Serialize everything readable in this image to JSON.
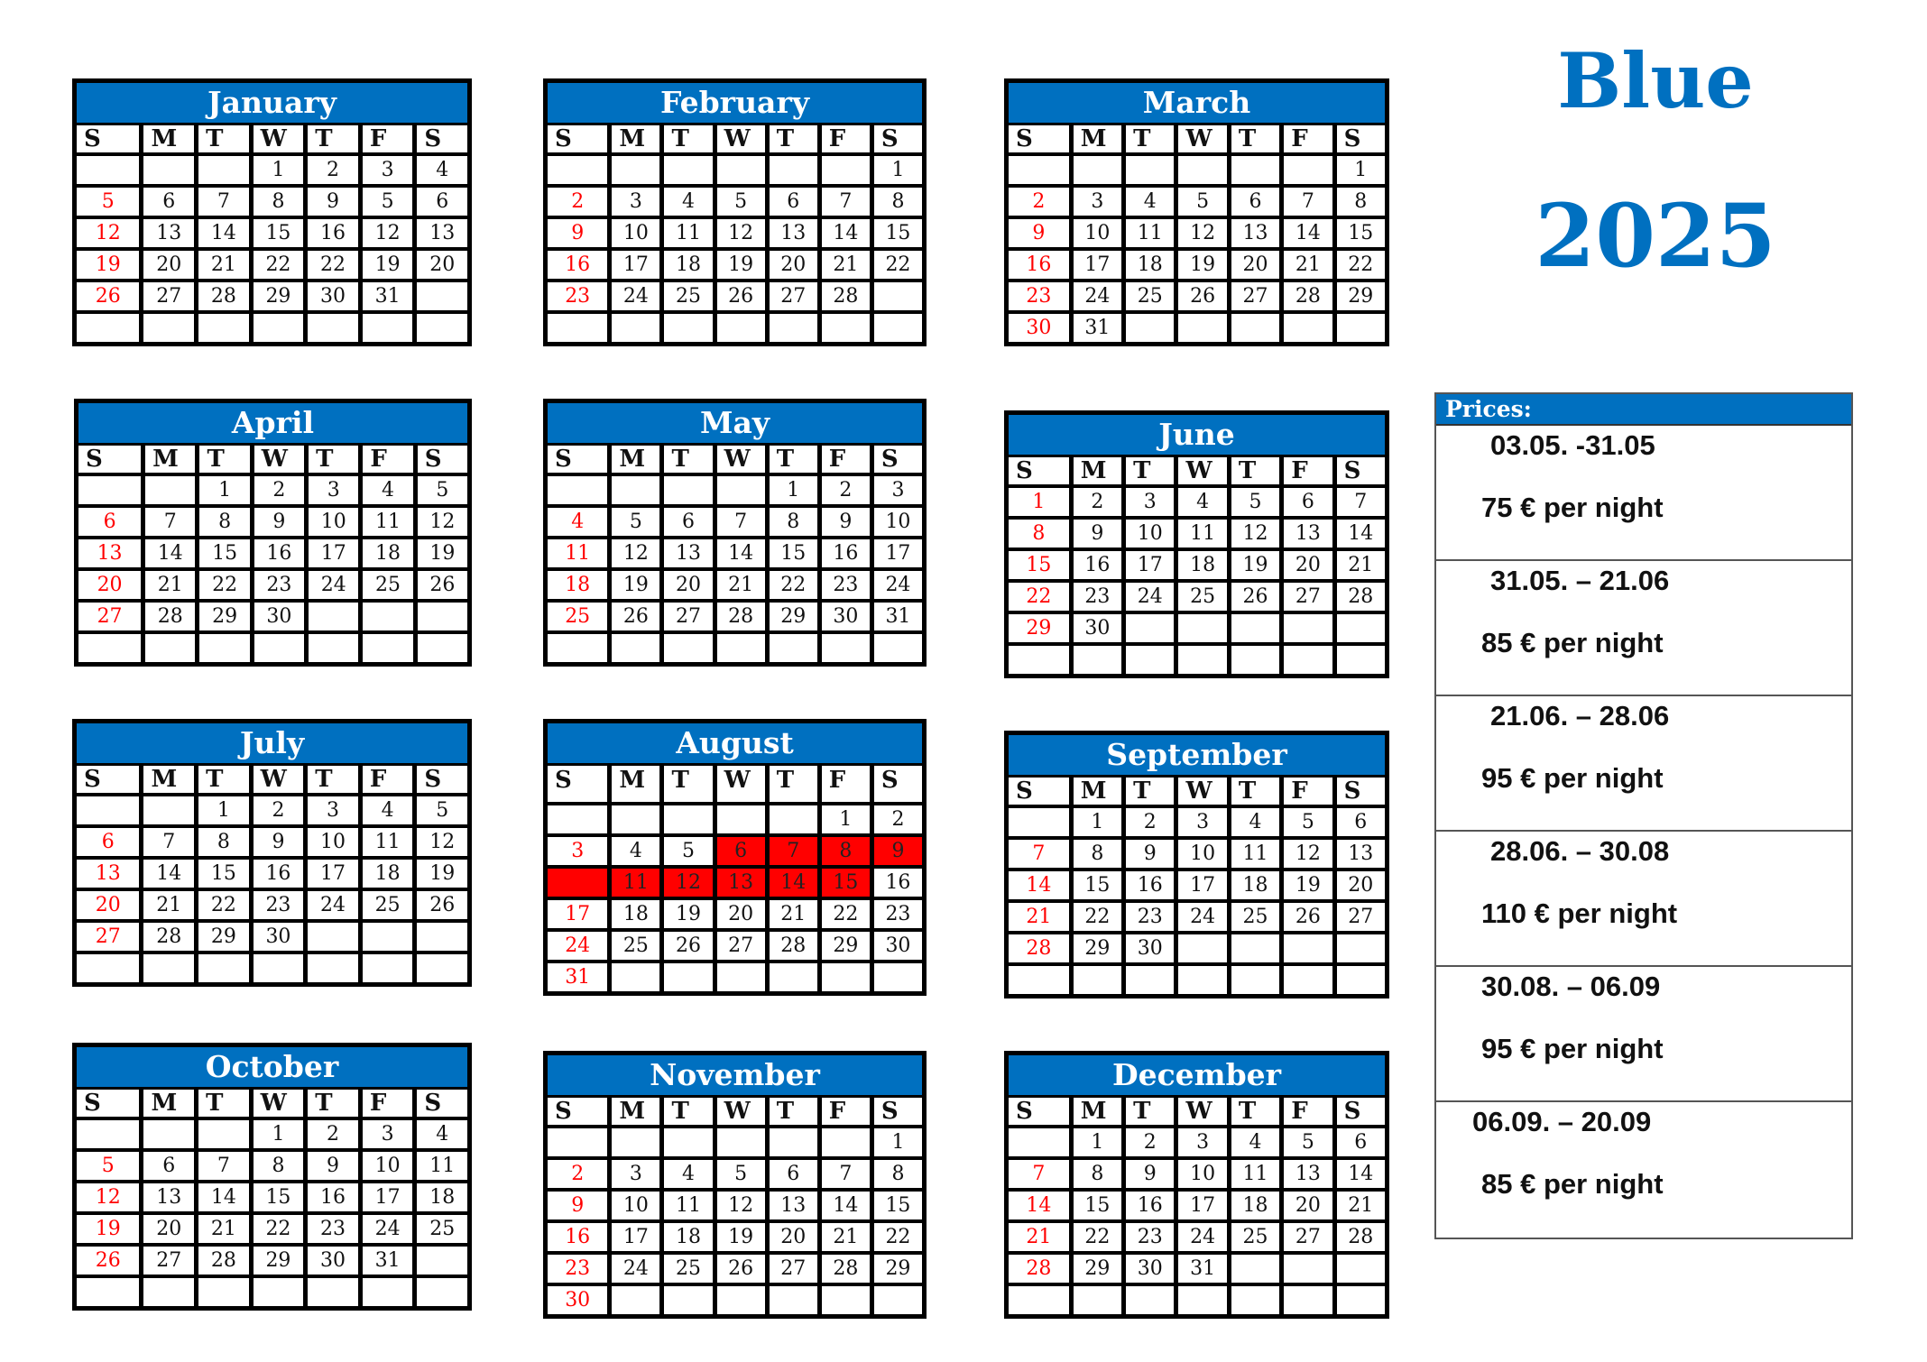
{
  "title": {
    "line1": "Blue",
    "line2": "2025"
  },
  "colors": {
    "accent": "#0070c0",
    "sunday": "#ff0000",
    "booked": "#ff0000"
  },
  "weekdays": [
    "S",
    "M",
    "T",
    "W",
    "T",
    "F",
    "S"
  ],
  "months": [
    {
      "name": "January",
      "weeks": [
        [
          "",
          "",
          "",
          "1",
          "2",
          "3",
          "4"
        ],
        [
          "5",
          "6",
          "7",
          "8",
          "9",
          "5",
          "6"
        ],
        [
          "12",
          "13",
          "14",
          "15",
          "16",
          "12",
          "13"
        ],
        [
          "19",
          "20",
          "21",
          "22",
          "22",
          "19",
          "20"
        ],
        [
          "26",
          "27",
          "28",
          "29",
          "30",
          "31",
          ""
        ],
        [
          "",
          "",
          "",
          "",
          "",
          "",
          ""
        ]
      ]
    },
    {
      "name": "February",
      "weeks": [
        [
          "",
          "",
          "",
          "",
          "",
          "",
          "1"
        ],
        [
          "2",
          "3",
          "4",
          "5",
          "6",
          "7",
          "8"
        ],
        [
          "9",
          "10",
          "11",
          "12",
          "13",
          "14",
          "15"
        ],
        [
          "16",
          "17",
          "18",
          "19",
          "20",
          "21",
          "22"
        ],
        [
          "23",
          "24",
          "25",
          "26",
          "27",
          "28",
          ""
        ],
        [
          "",
          "",
          "",
          "",
          "",
          "",
          ""
        ]
      ]
    },
    {
      "name": "March",
      "weeks": [
        [
          "",
          "",
          "",
          "",
          "",
          "",
          "1"
        ],
        [
          "2",
          "3",
          "4",
          "5",
          "6",
          "7",
          "8"
        ],
        [
          "9",
          "10",
          "11",
          "12",
          "13",
          "14",
          "15"
        ],
        [
          "16",
          "17",
          "18",
          "19",
          "20",
          "21",
          "22"
        ],
        [
          "23",
          "24",
          "25",
          "26",
          "27",
          "28",
          "29"
        ],
        [
          "30",
          "31",
          "",
          "",
          "",
          "",
          ""
        ]
      ]
    },
    {
      "name": "April",
      "weeks": [
        [
          "",
          "",
          "1",
          "2",
          "3",
          "4",
          "5"
        ],
        [
          "6",
          "7",
          "8",
          "9",
          "10",
          "11",
          "12"
        ],
        [
          "13",
          "14",
          "15",
          "16",
          "17",
          "18",
          "19"
        ],
        [
          "20",
          "21",
          "22",
          "23",
          "24",
          "25",
          "26"
        ],
        [
          "27",
          "28",
          "29",
          "30",
          "",
          "",
          ""
        ],
        [
          "",
          "",
          "",
          "",
          "",
          "",
          ""
        ]
      ]
    },
    {
      "name": "May",
      "weeks": [
        [
          "",
          "",
          "",
          "",
          "1",
          "2",
          "3"
        ],
        [
          "4",
          "5",
          "6",
          "7",
          "8",
          "9",
          "10"
        ],
        [
          "11",
          "12",
          "13",
          "14",
          "15",
          "16",
          "17"
        ],
        [
          "18",
          "19",
          "20",
          "21",
          "22",
          "23",
          "24"
        ],
        [
          "25",
          "26",
          "27",
          "28",
          "29",
          "30",
          "31"
        ],
        [
          "",
          "",
          "",
          "",
          "",
          "",
          ""
        ]
      ]
    },
    {
      "name": "June",
      "weeks": [
        [
          "1",
          "2",
          "3",
          "4",
          "5",
          "6",
          "7"
        ],
        [
          "8",
          "9",
          "10",
          "11",
          "12",
          "13",
          "14"
        ],
        [
          "15",
          "16",
          "17",
          "18",
          "19",
          "20",
          "21"
        ],
        [
          "22",
          "23",
          "24",
          "25",
          "26",
          "27",
          "28"
        ],
        [
          "29",
          "30",
          "",
          "",
          "",
          "",
          ""
        ],
        [
          "",
          "",
          "",
          "",
          "",
          "",
          ""
        ]
      ]
    },
    {
      "name": "July",
      "weeks": [
        [
          "",
          "",
          "1",
          "2",
          "3",
          "4",
          "5"
        ],
        [
          "6",
          "7",
          "8",
          "9",
          "10",
          "11",
          "12"
        ],
        [
          "13",
          "14",
          "15",
          "16",
          "17",
          "18",
          "19"
        ],
        [
          "20",
          "21",
          "22",
          "23",
          "24",
          "25",
          "26"
        ],
        [
          "27",
          "28",
          "29",
          "30",
          "",
          "",
          ""
        ],
        [
          "",
          "",
          "",
          "",
          "",
          "",
          ""
        ]
      ]
    },
    {
      "name": "August",
      "weeks": [
        [
          "",
          "",
          "",
          "",
          "",
          "1",
          "2"
        ],
        [
          "3",
          "4",
          "5",
          "6",
          "7",
          "8",
          "9"
        ],
        [
          "",
          "11",
          "12",
          "13",
          "14",
          "15",
          "16"
        ],
        [
          "17",
          "18",
          "19",
          "20",
          "21",
          "22",
          "23"
        ],
        [
          "24",
          "25",
          "26",
          "27",
          "28",
          "29",
          "30"
        ],
        [
          "31",
          "",
          "",
          "",
          "",
          "",
          ""
        ]
      ],
      "booked": [
        [
          1,
          3
        ],
        [
          1,
          4
        ],
        [
          1,
          5
        ],
        [
          1,
          6
        ],
        [
          2,
          0
        ],
        [
          2,
          1
        ],
        [
          2,
          2
        ],
        [
          2,
          3
        ],
        [
          2,
          4
        ],
        [
          2,
          5
        ]
      ]
    },
    {
      "name": "September",
      "weeks": [
        [
          "",
          "1",
          "2",
          "3",
          "4",
          "5",
          "6"
        ],
        [
          "7",
          "8",
          "9",
          "10",
          "11",
          "12",
          "13"
        ],
        [
          "14",
          "15",
          "16",
          "17",
          "18",
          "19",
          "20"
        ],
        [
          "21",
          "22",
          "23",
          "24",
          "25",
          "26",
          "27"
        ],
        [
          "28",
          "29",
          "30",
          "",
          "",
          "",
          ""
        ],
        [
          "",
          "",
          "",
          "",
          "",
          "",
          ""
        ]
      ]
    },
    {
      "name": "October",
      "weeks": [
        [
          "",
          "",
          "",
          "1",
          "2",
          "3",
          "4"
        ],
        [
          "5",
          "6",
          "7",
          "8",
          "9",
          "10",
          "11"
        ],
        [
          "12",
          "13",
          "14",
          "15",
          "16",
          "17",
          "18"
        ],
        [
          "19",
          "20",
          "21",
          "22",
          "23",
          "24",
          "25"
        ],
        [
          "26",
          "27",
          "28",
          "29",
          "30",
          "31",
          ""
        ],
        [
          "",
          "",
          "",
          "",
          "",
          "",
          ""
        ]
      ]
    },
    {
      "name": "November",
      "weeks": [
        [
          "",
          "",
          "",
          "",
          "",
          "",
          "1"
        ],
        [
          "2",
          "3",
          "4",
          "5",
          "6",
          "7",
          "8"
        ],
        [
          "9",
          "10",
          "11",
          "12",
          "13",
          "14",
          "15"
        ],
        [
          "16",
          "17",
          "18",
          "19",
          "20",
          "21",
          "22"
        ],
        [
          "23",
          "24",
          "25",
          "26",
          "27",
          "28",
          "29"
        ],
        [
          "30",
          "",
          "",
          "",
          "",
          "",
          ""
        ]
      ]
    },
    {
      "name": "December",
      "weeks": [
        [
          "",
          "1",
          "2",
          "3",
          "4",
          "5",
          "6"
        ],
        [
          "7",
          "8",
          "9",
          "10",
          "11",
          "13",
          "14"
        ],
        [
          "14",
          "15",
          "16",
          "17",
          "18",
          "20",
          "21"
        ],
        [
          "21",
          "22",
          "23",
          "24",
          "25",
          "27",
          "28"
        ],
        [
          "28",
          "29",
          "30",
          "31",
          "",
          "",
          ""
        ],
        [
          "",
          "",
          "",
          "",
          "",
          "",
          ""
        ]
      ]
    }
  ],
  "prices": {
    "header": "Prices:",
    "periods": [
      {
        "range": "03.05. -31.05",
        "price": "75 € per night"
      },
      {
        "range": "31.05. – 21.06",
        "price": "85 € per night"
      },
      {
        "range": "21.06. – 28.06",
        "price": "95 € per night"
      },
      {
        "range": "28.06. – 30.08",
        "price": "110 € per night"
      },
      {
        "range": "30.08. – 06.09",
        "price": "95 € per night"
      },
      {
        "range": "06.09. – 20.09",
        "price": "85 € per night"
      }
    ]
  }
}
